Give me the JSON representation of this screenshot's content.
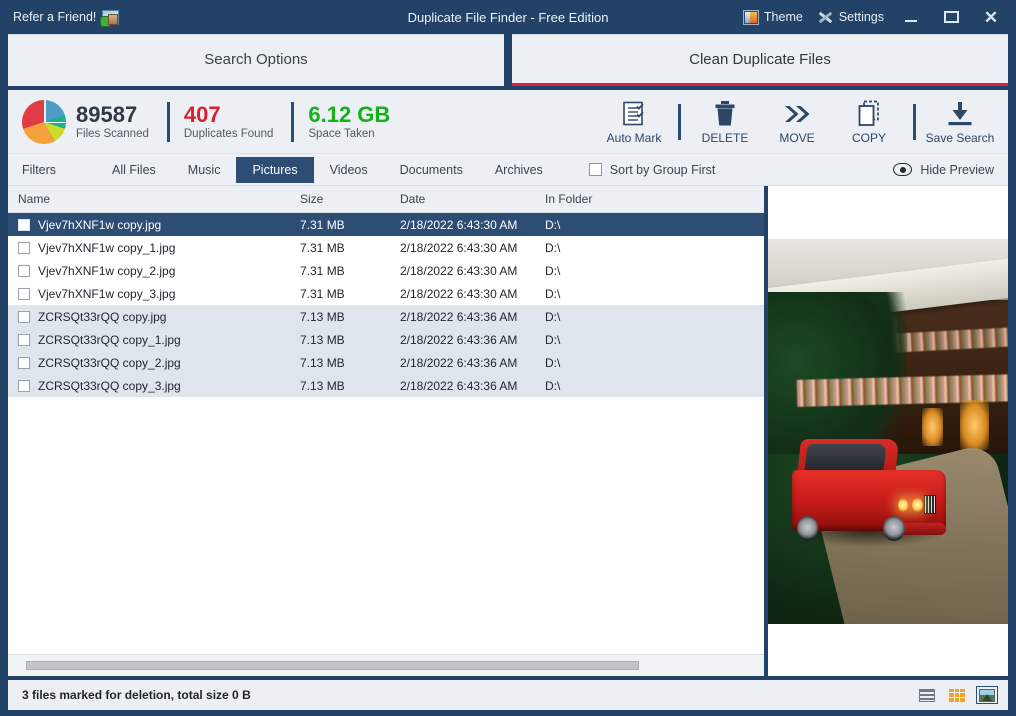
{
  "titlebar": {
    "refer_label": "Refer a Friend!",
    "refer_icon": "gift-image-icon",
    "window_title": "Duplicate File Finder - Free Edition",
    "theme_label": "Theme",
    "settings_label": "Settings",
    "minimize_label": "–",
    "maximize_label": "❐",
    "close_label": "✕"
  },
  "tabs": [
    {
      "label": "Search Options",
      "active": false
    },
    {
      "label": "Clean Duplicate Files",
      "active": true
    }
  ],
  "stats": [
    {
      "value": "89587",
      "label": "Files Scanned",
      "color": "#2f3a46"
    },
    {
      "value": "407",
      "label": "Duplicates Found",
      "color": "#d9202e"
    },
    {
      "value": "6.12 GB",
      "label": "Space Taken",
      "color": "#12b319"
    }
  ],
  "actions": [
    {
      "label": "Auto Mark",
      "icon": "checklist-icon"
    },
    {
      "label": "DELETE",
      "icon": "trash-icon"
    },
    {
      "label": "MOVE",
      "icon": "double-chevron-right-icon"
    },
    {
      "label": "COPY",
      "icon": "copy-pages-icon"
    },
    {
      "label": "Save Search",
      "icon": "download-icon"
    }
  ],
  "filters": {
    "label": "Filters",
    "items": [
      {
        "label": "All Files",
        "active": false
      },
      {
        "label": "Music",
        "active": false
      },
      {
        "label": "Pictures",
        "active": true
      },
      {
        "label": "Videos",
        "active": false
      },
      {
        "label": "Documents",
        "active": false
      },
      {
        "label": "Archives",
        "active": false
      }
    ],
    "sort_checkbox_label": "Sort by Group First",
    "sort_checkbox_checked": false,
    "preview_toggle_label": "Hide Preview",
    "preview_toggle_icon": "eye-icon"
  },
  "table": {
    "columns": [
      "Name",
      "Size",
      "Date",
      "In Folder"
    ],
    "rows": [
      {
        "name": "Vjev7hXNF1w copy.jpg",
        "size": "7.31 MB",
        "date": "2/18/2022 6:43:30 AM",
        "folder": "D:\\",
        "checked": false,
        "state": "selected"
      },
      {
        "name": "Vjev7hXNF1w copy_1.jpg",
        "size": "7.31 MB",
        "date": "2/18/2022 6:43:30 AM",
        "folder": "D:\\",
        "checked": false,
        "state": "normal"
      },
      {
        "name": "Vjev7hXNF1w copy_2.jpg",
        "size": "7.31 MB",
        "date": "2/18/2022 6:43:30 AM",
        "folder": "D:\\",
        "checked": false,
        "state": "normal"
      },
      {
        "name": "Vjev7hXNF1w copy_3.jpg",
        "size": "7.31 MB",
        "date": "2/18/2022 6:43:30 AM",
        "folder": "D:\\",
        "checked": false,
        "state": "normal"
      },
      {
        "name": "ZCRSQt33rQQ copy.jpg",
        "size": "7.13 MB",
        "date": "2/18/2022 6:43:36 AM",
        "folder": "D:\\",
        "checked": false,
        "state": "alt"
      },
      {
        "name": "ZCRSQt33rQQ copy_1.jpg",
        "size": "7.13 MB",
        "date": "2/18/2022 6:43:36 AM",
        "folder": "D:\\",
        "checked": false,
        "state": "alt"
      },
      {
        "name": "ZCRSQt33rQQ copy_2.jpg",
        "size": "7.13 MB",
        "date": "2/18/2022 6:43:36 AM",
        "folder": "D:\\",
        "checked": false,
        "state": "alt"
      },
      {
        "name": "ZCRSQt33rQQ copy_3.jpg",
        "size": "7.13 MB",
        "date": "2/18/2022 6:43:36 AM",
        "folder": "D:\\",
        "checked": false,
        "state": "alt"
      }
    ]
  },
  "preview": {
    "alt": "Red BMW E30 M3 parked on a gravel path in front of a wood house covered with greenery and flower boxes at dusk"
  },
  "statusbar": {
    "text": "3 files marked for deletion, total size 0 B",
    "views": [
      {
        "icon": "list-view-icon",
        "active": false
      },
      {
        "icon": "grid-view-icon",
        "active": false
      },
      {
        "icon": "thumbnail-view-icon",
        "active": true
      }
    ]
  },
  "colors": {
    "window_chrome": "#234267",
    "panel_bg": "#eceff3",
    "accent_red": "#d81e3f",
    "selection": "#2d4d74",
    "duplicates_red": "#d9202e",
    "space_green": "#12b319"
  }
}
